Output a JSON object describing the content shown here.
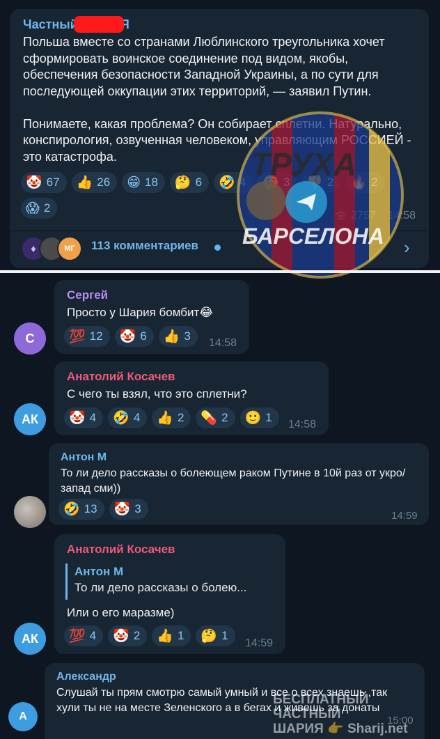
{
  "post": {
    "channel_name": "Частный ШАРИЯ",
    "text": "Польша вместе со странами Люблинского треугольника хочет сформировать воинское соединение под видом, якобы, обеспечения безопасности Западной Украины, а по сути для последующей оккупации этих территорий, — заявил Путин.\n\nПонимаете, какая проблема? Он собирает сплетни. Натурально, конспирология, озвученная человеком, управляющим РОССИЕЙ - это катастрофа.",
    "reactions": [
      {
        "emoji": "🤡",
        "count": "67"
      },
      {
        "emoji": "👍",
        "count": "26"
      },
      {
        "emoji": "😁",
        "count": "18"
      },
      {
        "emoji": "🤔",
        "count": "6"
      },
      {
        "emoji": "🤣",
        "count": "4"
      },
      {
        "emoji": "🥱",
        "count": "3"
      },
      {
        "emoji": "👎",
        "count": "2"
      },
      {
        "emoji": "🔥",
        "count": "2"
      },
      {
        "emoji": "😱",
        "count": "2"
      }
    ],
    "views": "2757",
    "time": "14:58",
    "comments_label": "113 комментариев",
    "commenter_avatar_initials": "МГ"
  },
  "watermark": {
    "top": "ТРУХА",
    "bottom": "БАРСЕЛОНА",
    "footer_line1": "БЕСПЛАТНЫЙ ЧАСТНЫЙ",
    "footer_line2": "ШАРИЯ 👉 Sharij.net"
  },
  "comments": [
    {
      "author": "Сергей",
      "author_color": "#b58cf0",
      "avatar_letter": "С",
      "avatar_color": "#8e6ad8",
      "text": "Просто у Шария бомбит😂",
      "reactions": [
        {
          "emoji": "💯",
          "count": "12"
        },
        {
          "emoji": "🤡",
          "count": "6"
        },
        {
          "emoji": "👍",
          "count": "3"
        }
      ],
      "time": "14:58"
    },
    {
      "author": "Анатолий Косачев",
      "author_color": "#ee5a7b",
      "avatar_letter": "АК",
      "avatar_color": "#3e9de0",
      "text": "С чего ты взял, что это сплетни?",
      "reactions": [
        {
          "emoji": "🤡",
          "count": "4"
        },
        {
          "emoji": "🤣",
          "count": "4"
        },
        {
          "emoji": "👍",
          "count": "2"
        },
        {
          "emoji": "💊",
          "count": "2"
        },
        {
          "emoji": "🙂",
          "count": "1"
        }
      ],
      "time": "14:58"
    },
    {
      "author": "Антон М",
      "author_color": "#6fb6ea",
      "avatar_letter": "",
      "avatar_color": "#8a8a8a",
      "text": "То ли дело рассказы о болеющем раком Путине в 10й раз от укро/запад сми))",
      "reactions": [
        {
          "emoji": "🤣",
          "count": "13"
        },
        {
          "emoji": "🤡",
          "count": "3"
        }
      ],
      "time": "14:59"
    },
    {
      "author": "Анатолий Косачев",
      "author_color": "#ee5a7b",
      "avatar_letter": "АК",
      "avatar_color": "#3e9de0",
      "reply_author": "Антон М",
      "reply_text": "То ли дело рассказы о болею...",
      "text": "Или о его маразме)",
      "reactions": [
        {
          "emoji": "💯",
          "count": "4"
        },
        {
          "emoji": "🤡",
          "count": "2"
        },
        {
          "emoji": "👍",
          "count": "1"
        },
        {
          "emoji": "🤔",
          "count": "1"
        }
      ],
      "time": "14:59"
    },
    {
      "author": "Александр",
      "author_color": "#6fb6ea",
      "avatar_letter": "А",
      "avatar_color": "#3e9de0",
      "text": "Слушай ты прям смотрю самый умный и все о всех знаешь ,так хули ты не на месте Зеленского а в бегах и живешь за донаты",
      "time": "15:00"
    }
  ]
}
